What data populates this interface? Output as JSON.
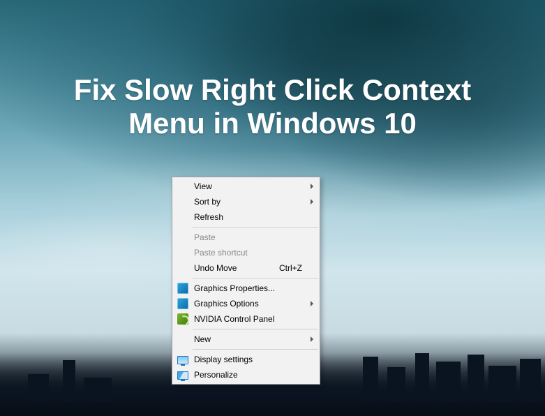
{
  "title_line1": "Fix Slow Right Click Context",
  "title_line2": "Menu in Windows 10",
  "menu": {
    "view": "View",
    "sort_by": "Sort by",
    "refresh": "Refresh",
    "paste": "Paste",
    "paste_shortcut": "Paste shortcut",
    "undo_move": "Undo Move",
    "undo_move_shortcut": "Ctrl+Z",
    "graphics_properties": "Graphics Properties...",
    "graphics_options": "Graphics Options",
    "nvidia_control_panel": "NVIDIA Control Panel",
    "new": "New",
    "display_settings": "Display settings",
    "personalize": "Personalize"
  }
}
